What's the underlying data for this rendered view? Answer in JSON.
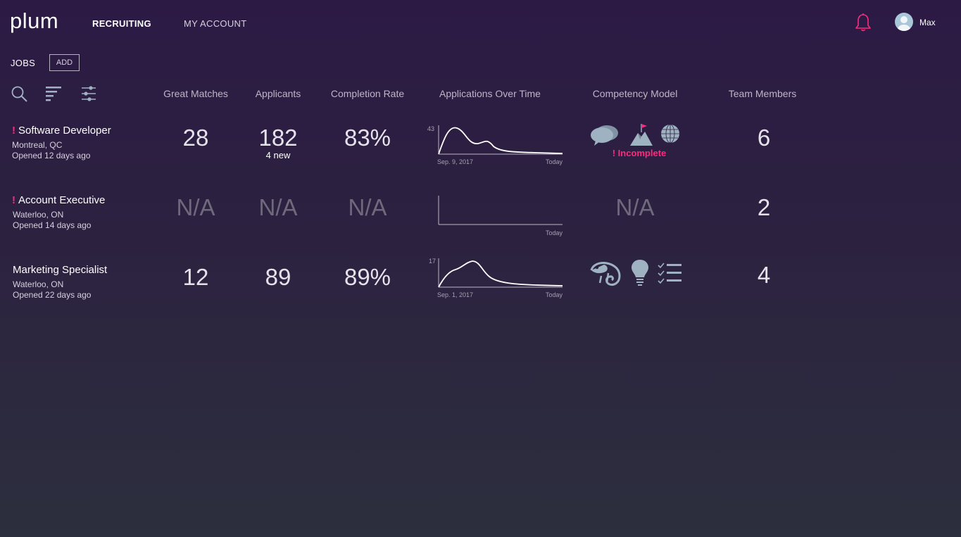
{
  "app": {
    "logo": "plum"
  },
  "nav": {
    "recruiting": "RECRUITING",
    "my_account": "MY ACCOUNT"
  },
  "user": {
    "name": "Max"
  },
  "jobs_header": {
    "label": "JOBS",
    "add_label": "ADD"
  },
  "columns": {
    "great_matches": "Great Matches",
    "applicants": "Applicants",
    "completion_rate": "Completion Rate",
    "applications_over_time": "Applications Over Time",
    "competency_model": "Competency Model",
    "team_members": "Team Members"
  },
  "jobs": [
    {
      "alert": "!",
      "title": "Software Developer",
      "location": "Montreal, QC",
      "opened": "Opened 12 days ago",
      "great_matches": "28",
      "applicants": "182",
      "applicants_new": "4 new",
      "completion_rate": "83%",
      "chart": {
        "max": "43",
        "start": "Sep. 9, 2017",
        "end": "Today"
      },
      "competency_status": "! Incomplete",
      "competency_icons": [
        "speech-bubbles-icon",
        "mountain-flag-icon",
        "globe-icon"
      ],
      "team_members": "6"
    },
    {
      "alert": "!",
      "title": "Account Executive",
      "location": "Waterloo, ON",
      "opened": "Opened 14 days ago",
      "great_matches": "N/A",
      "applicants": "N/A",
      "completion_rate": "N/A",
      "chart": {
        "end": "Today"
      },
      "competency": "N/A",
      "team_members": "2"
    },
    {
      "title": "Marketing Specialist",
      "location": "Waterloo, ON",
      "opened": "Opened 22 days ago",
      "great_matches": "12",
      "applicants": "89",
      "completion_rate": "89%",
      "chart": {
        "max": "17",
        "start": "Sep. 1, 2017",
        "end": "Today"
      },
      "competency_icons": [
        "chameleon-icon",
        "lightbulb-icon",
        "checklist-icon"
      ],
      "team_members": "4"
    }
  ],
  "colors": {
    "accent": "#ff2a7f",
    "icon": "#9fb2c2",
    "na": "#6e6a7c"
  }
}
